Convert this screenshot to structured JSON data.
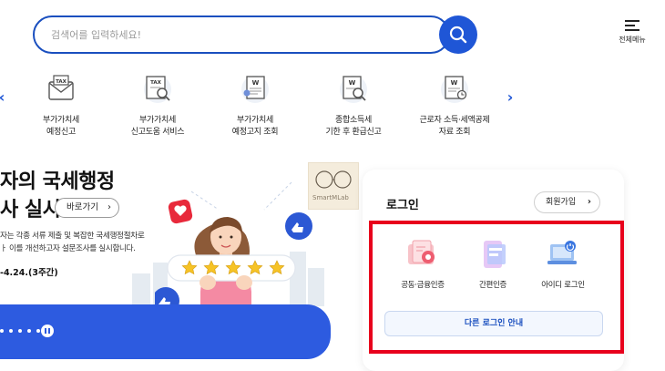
{
  "search": {
    "placeholder": "검색어를 입력하세요!"
  },
  "header": {
    "all_menu_label": "전체메뉴"
  },
  "services": [
    {
      "line1": "부가가치세",
      "line2": "예정신고",
      "icon": "tax-envelope-icon"
    },
    {
      "line1": "부가가치세",
      "line2": "신고도움 서비스",
      "icon": "tax-search-icon"
    },
    {
      "line1": "부가가치세",
      "line2": "예정고지 조회",
      "icon": "notice-document-icon"
    },
    {
      "line1": "종합소득세",
      "line2": "기한 후 환급신고",
      "icon": "refund-search-icon"
    },
    {
      "line1": "근로자 소득·세액공제",
      "line2": "자료 조회",
      "icon": "worker-document-icon"
    }
  ],
  "banner": {
    "title_line1": "자의 국세행정",
    "title_line2": "사 실시",
    "button_label": "바로가기",
    "desc_line1": "자는 각종 서류 제출 및 복잡한 국세행정절차로",
    "desc_line2": "ㅏ 이를 개선하고자 설문조사를 실시합니다.",
    "period": "-4.24.(3주간)"
  },
  "watermark": {
    "text": "SmartMLab"
  },
  "login": {
    "title": "로그인",
    "signup_label": "회원가입",
    "options": [
      {
        "label": "공동·금융인증",
        "icon": "certificate-icon"
      },
      {
        "label": "간편인증",
        "icon": "simple-auth-icon"
      },
      {
        "label": "아이디 로그인",
        "icon": "id-login-icon"
      }
    ],
    "other_login_label": "다른 로그인 안내"
  },
  "colors": {
    "primary": "#1f56d6",
    "highlight": "#e8001c",
    "banner_blue": "#2d5be0"
  }
}
